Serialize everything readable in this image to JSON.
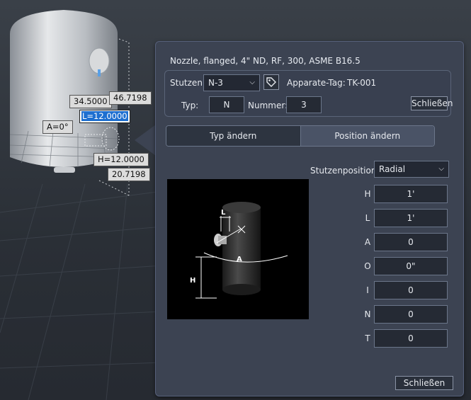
{
  "viewport": {
    "dimensions": {
      "d1": "34.5000",
      "d2": "46.7198",
      "l": "L=12.0000",
      "a": "A=0°",
      "h": "H=12.0000",
      "d3": "20.7198"
    }
  },
  "dialog": {
    "title": "Nozzle, flanged, 4\" ND, RF, 300, ASME B16.5",
    "stutzen_label": "Stutzen:",
    "stutzen_value": "N-3",
    "apparate_label": "Apparate-Tag:",
    "apparate_value": "TK-001",
    "typ_label": "Typ:",
    "typ_value": "N",
    "nummer_label": "Nummer:",
    "nummer_value": "3",
    "close_top_label": "Schließen",
    "tabs": {
      "typ": "Typ ändern",
      "position": "Position ändern"
    },
    "stutzenposition_label": "Stutzenposition:",
    "stutzenposition_value": "Radial",
    "params": [
      {
        "label": "H",
        "value": "1'"
      },
      {
        "label": "L",
        "value": "1'"
      },
      {
        "label": "A",
        "value": "0"
      },
      {
        "label": "O",
        "value": "0\""
      },
      {
        "label": "I",
        "value": "0"
      },
      {
        "label": "N",
        "value": "0"
      },
      {
        "label": "T",
        "value": "0"
      }
    ],
    "close_bottom_label": "Schließen",
    "preview_labels": {
      "l": "L",
      "a": "A",
      "h": "H"
    }
  },
  "icons": {
    "tag": "tag-icon",
    "chevron": "chevron-down-icon"
  },
  "colors": {
    "panel": "#3c4352",
    "field": "#252a34",
    "selection": "#1e6fd0"
  }
}
